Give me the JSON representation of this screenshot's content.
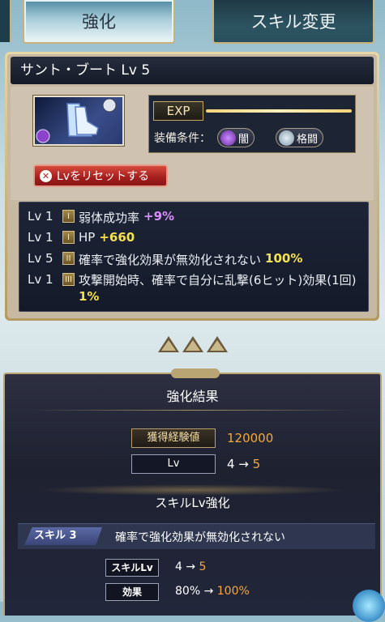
{
  "tabs": {
    "enhance": "強化",
    "skill_change": "スキル変更"
  },
  "item": {
    "name": "サント・ブート Lv 5",
    "exp_label": "EXP",
    "equip_condition_label": "装備条件：",
    "conditions": [
      {
        "label": "闇",
        "icon": "dark-element-icon"
      },
      {
        "label": "格闘",
        "icon": "fist-weapon-icon"
      }
    ],
    "reset_button": "Lvをリセットする"
  },
  "stats": [
    {
      "lv": "Lv 1",
      "rank": "I",
      "label": "弱体成功率",
      "value": "+9%",
      "value_color": "#d98cff"
    },
    {
      "lv": "Lv 1",
      "rank": "I",
      "label": "HP",
      "value": "+660",
      "value_color": "#f6e24f"
    },
    {
      "lv": "Lv 5",
      "rank": "II",
      "label": "確率で強化効果が無効化されない",
      "value": "100%",
      "value_color": "#f6e24f"
    },
    {
      "lv": "Lv 1",
      "rank": "III",
      "label": "攻撃開始時、確率で自分に乱撃(6ヒット)効果(1回)",
      "value": "1%",
      "value_color": "#f6e24f"
    }
  ],
  "result": {
    "title": "強化結果",
    "exp_gain_label": "獲得経験値",
    "exp_gain_value": "120000",
    "lv_label": "Lv",
    "lv_from": "4 →",
    "lv_to": "5",
    "skill_section_title": "スキルLv強化",
    "skill_tag": "スキル 3",
    "skill_name": "確率で強化効果が無効化されない",
    "skill_lv_label": "スキルLv",
    "skill_lv_from": "4 →",
    "skill_lv_to": "5",
    "effect_label": "効果",
    "effect_from": "80% →",
    "effect_to": "100%"
  },
  "colors": {
    "accent_gold": "#c8b27a",
    "value_orange": "#f6a83c"
  }
}
